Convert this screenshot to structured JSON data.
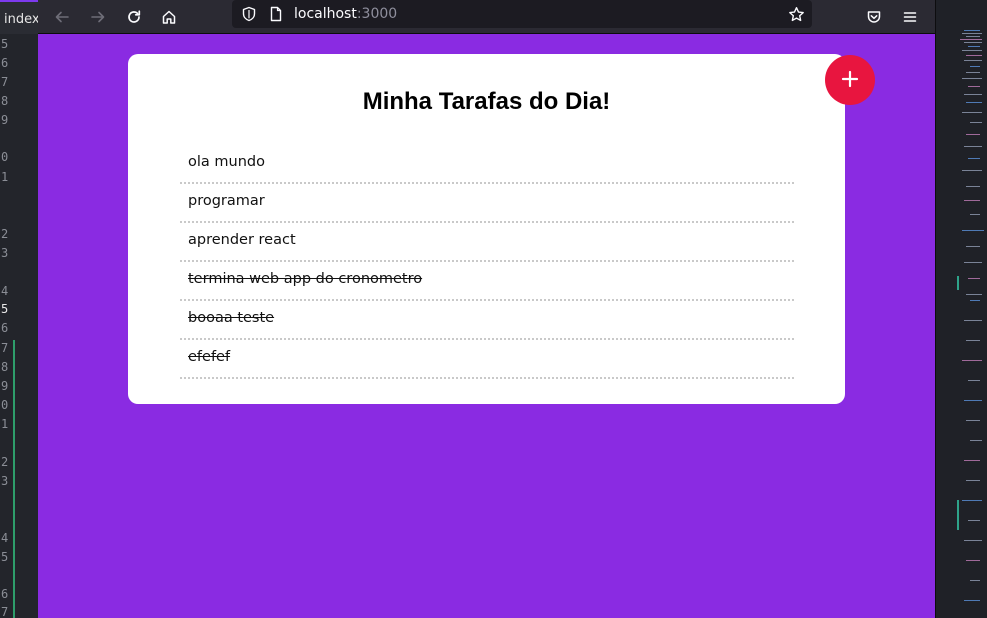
{
  "editor": {
    "tab_label": "index.",
    "line_numbers": [
      "5",
      "6",
      "7",
      "8",
      "9",
      "0",
      "1",
      "2",
      "3",
      "4",
      "5",
      "6",
      "7",
      "8",
      "9",
      "0",
      "1",
      "2",
      "3",
      "4",
      "5",
      "6",
      "7"
    ]
  },
  "browser": {
    "url_host": "localhost",
    "url_port": ":3000"
  },
  "app": {
    "title": "Minha Tarafas do Dia!",
    "add_button_label": "+",
    "tasks": [
      {
        "text": "ola mundo",
        "done": false
      },
      {
        "text": "programar",
        "done": false
      },
      {
        "text": "aprender react",
        "done": false
      },
      {
        "text": "termina web app do cronometro",
        "done": true
      },
      {
        "text": "booaa teste",
        "done": true
      },
      {
        "text": "efefef",
        "done": true
      }
    ]
  },
  "colors": {
    "page_background": "#8a2be2",
    "card_background": "#ffffff",
    "add_button": "#e8153f",
    "toolbar": "#2b2a33",
    "urlbar": "#1c1b22"
  },
  "icons": {
    "toolbar": [
      "back-arrow-icon",
      "forward-arrow-icon",
      "reload-icon",
      "home-icon",
      "shield-icon",
      "page-icon",
      "bookmark-star-icon",
      "pocket-icon",
      "menu-icon"
    ]
  }
}
